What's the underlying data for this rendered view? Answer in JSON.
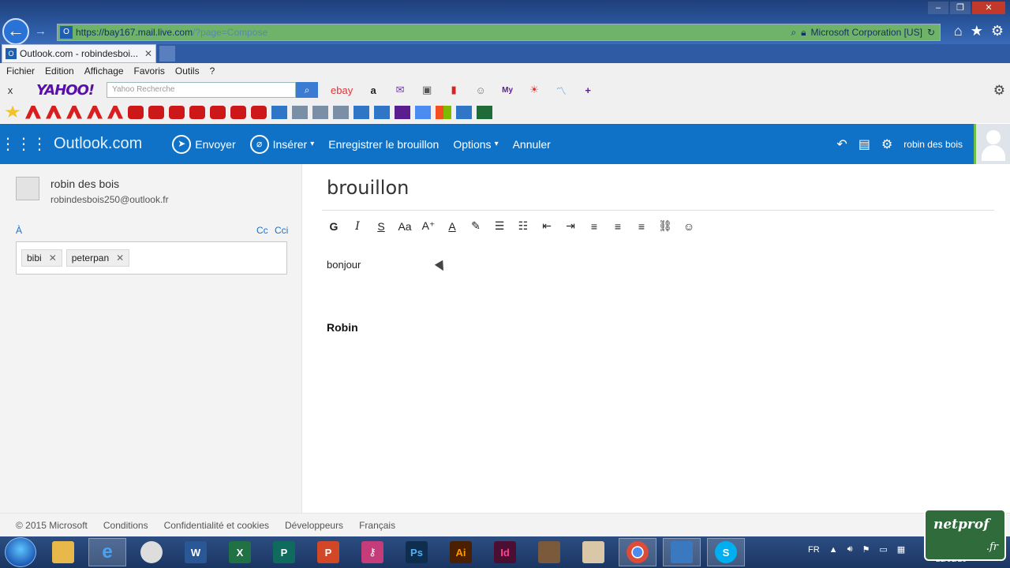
{
  "browser": {
    "url_host": "https://bay167.mail.live.com",
    "url_path": "/?page=Compose",
    "site_identity": "Microsoft Corporation [US]",
    "tab_title": "Outlook.com - robindesboi...",
    "window_controls": [
      "–",
      "❐",
      "✕"
    ]
  },
  "menubar": {
    "items": [
      "Fichier",
      "Edition",
      "Affichage",
      "Favoris",
      "Outils",
      "?"
    ]
  },
  "yahoo_toolbar": {
    "close": "x",
    "logo": "YAHOO!",
    "search_placeholder": "Yahoo Recherche",
    "ebay": "ebay",
    "amazon": "a"
  },
  "outlook": {
    "brand": "Outlook.com",
    "send": "Envoyer",
    "insert": "Insérer",
    "save_draft": "Enregistrer le brouillon",
    "options": "Options",
    "cancel": "Annuler",
    "user": "robin des bois"
  },
  "compose": {
    "sender_name": "robin des bois",
    "sender_email": "robindesbois250@outlook.fr",
    "to_label": "À",
    "cc_label": "Cc",
    "bcc_label": "Cci",
    "recipients": [
      "bibi",
      "peterpan"
    ],
    "subject": "brouillon",
    "body_line1": "bonjour",
    "body_line2": "Robin"
  },
  "format_toolbar": {
    "bold": "G",
    "italic": "I",
    "strike": "S",
    "font_size": "Aa",
    "grow": "A⁺",
    "font_color": "A"
  },
  "footer": {
    "copyright": "© 2015 Microsoft",
    "terms": "Conditions",
    "privacy": "Confidentialité et cookies",
    "developers": "Développeurs",
    "language": "Français"
  },
  "taskbar": {
    "lang": "FR",
    "date": "21/01/20"
  },
  "watermark": {
    "name": "netprof",
    "suffix": ".fr"
  },
  "colors": {
    "outlook_blue": "#0f72c7",
    "link_blue": "#1a72c4"
  }
}
